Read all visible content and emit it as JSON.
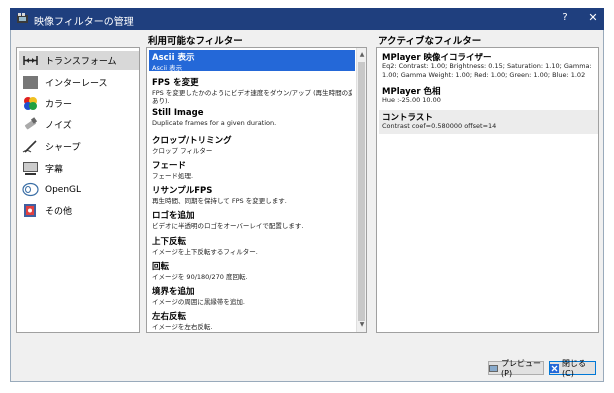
{
  "window": {
    "title": "映像フィルターの管理",
    "help_glyph": "?",
    "close_glyph": "✕"
  },
  "categories": [
    {
      "label": "トランスフォーム",
      "icon": "transform-icon",
      "selected": true
    },
    {
      "label": "インターレース",
      "icon": "interlace-icon",
      "selected": false
    },
    {
      "label": "カラー",
      "icon": "color-icon",
      "selected": false
    },
    {
      "label": "ノイズ",
      "icon": "noise-icon",
      "selected": false
    },
    {
      "label": "シャープ",
      "icon": "sharpen-icon",
      "selected": false
    },
    {
      "label": "字幕",
      "icon": "subtitle-icon",
      "selected": false
    },
    {
      "label": "OpenGL",
      "icon": "opengl-icon",
      "selected": false
    },
    {
      "label": "その他",
      "icon": "misc-icon",
      "selected": false
    }
  ],
  "available": {
    "heading": "利用可能なフィルター",
    "items": [
      {
        "title": "Ascii 表示",
        "desc": "Ascii 表示",
        "selected": true
      },
      {
        "title": "FPS を変更",
        "desc": "FPS を変更したかのようにビデオ速度をダウン/アップ (再生時間の変化",
        "desc2": "あり).",
        "selected": false
      },
      {
        "title": "Still Image",
        "desc": "Duplicate frames for a given duration.",
        "selected": false
      },
      {
        "title": "クロップ/トリミング",
        "desc": "クロップ フィルター",
        "selected": false
      },
      {
        "title": "フェード",
        "desc": "フェード処理.",
        "selected": false
      },
      {
        "title": "リサンプルFPS",
        "desc": "再生時間、同期を保持して FPS を変更します.",
        "selected": false
      },
      {
        "title": "ロゴを追加",
        "desc": "ビデオに半透明のロゴをオーバーレイで配置します.",
        "selected": false
      },
      {
        "title": "上下反転",
        "desc": "イメージを上下反転するフィルター.",
        "selected": false
      },
      {
        "title": "回転",
        "desc": "イメージを 90/180/270 度回転.",
        "selected": false
      },
      {
        "title": "境界を追加",
        "desc": "イメージの周囲に黒縁帯を追加.",
        "selected": false
      },
      {
        "title": "左右反転",
        "desc": "イメージを左右反転.",
        "selected": false
      }
    ]
  },
  "active": {
    "heading": "アクティブなフィルター",
    "items": [
      {
        "title": "MPlayer 映像イコライザー",
        "desc": "Eq2: Contrast: 1.00; Brightness: 0.15; Saturation: 1.10; Gamma: 1.00; Gamma Weight: 1.00; Red: 1.00; Green: 1.00; Blue: 1.02"
      },
      {
        "title": "MPlayer 色相",
        "desc": "Hue :-25.00 10.00"
      },
      {
        "title": "コントラスト",
        "desc": "Contrast coef=0.580000 offset=14"
      }
    ]
  },
  "buttons": {
    "preview": "プレビュー(P)",
    "close": "閉じる(C)"
  },
  "colors": {
    "titlebar": "#1f3f7e",
    "selection": "#2468d8"
  }
}
